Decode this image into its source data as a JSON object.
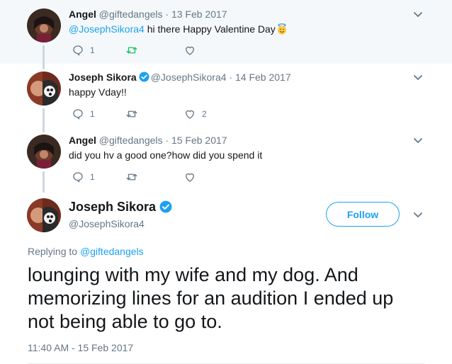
{
  "colors": {
    "accent": "#1da1f2",
    "retweet_active": "#17bf63",
    "muted": "#657786",
    "thread_bg": "#f5f8fa"
  },
  "replies": [
    {
      "name": "Angel",
      "handle": "@giftedangels",
      "date": "13 Feb 2017",
      "text_mention": "@JosephSikora4",
      "text": " hi there Happy Valentine Day",
      "emoji": "smiling-face-with-halo",
      "reply_count": "1",
      "retweet_active": true,
      "retweet_count": "",
      "like_count": ""
    },
    {
      "name": "Joseph Sikora",
      "verified": true,
      "handle": "@JosephSikora4",
      "date": "14 Feb 2017",
      "text": "happy Vday!!",
      "reply_count": "1",
      "retweet_count": "",
      "like_count": "2"
    },
    {
      "name": "Angel",
      "handle": "@giftedangels",
      "date": "15 Feb 2017",
      "text": "did you hv a good one?how did you spend it",
      "reply_count": "1",
      "retweet_count": "",
      "like_count": ""
    }
  ],
  "main_tweet": {
    "name": "Joseph Sikora",
    "verified": true,
    "handle": "@JosephSikora4",
    "follow_label": "Follow",
    "replying_label": "Replying to",
    "replying_to": "@giftedangels",
    "text": "lounging with my wife and my dog. And memorizing lines for an audition I ended up not being able to go to.",
    "timestamp": "11:40 AM - 15 Feb 2017"
  },
  "separator": "·"
}
